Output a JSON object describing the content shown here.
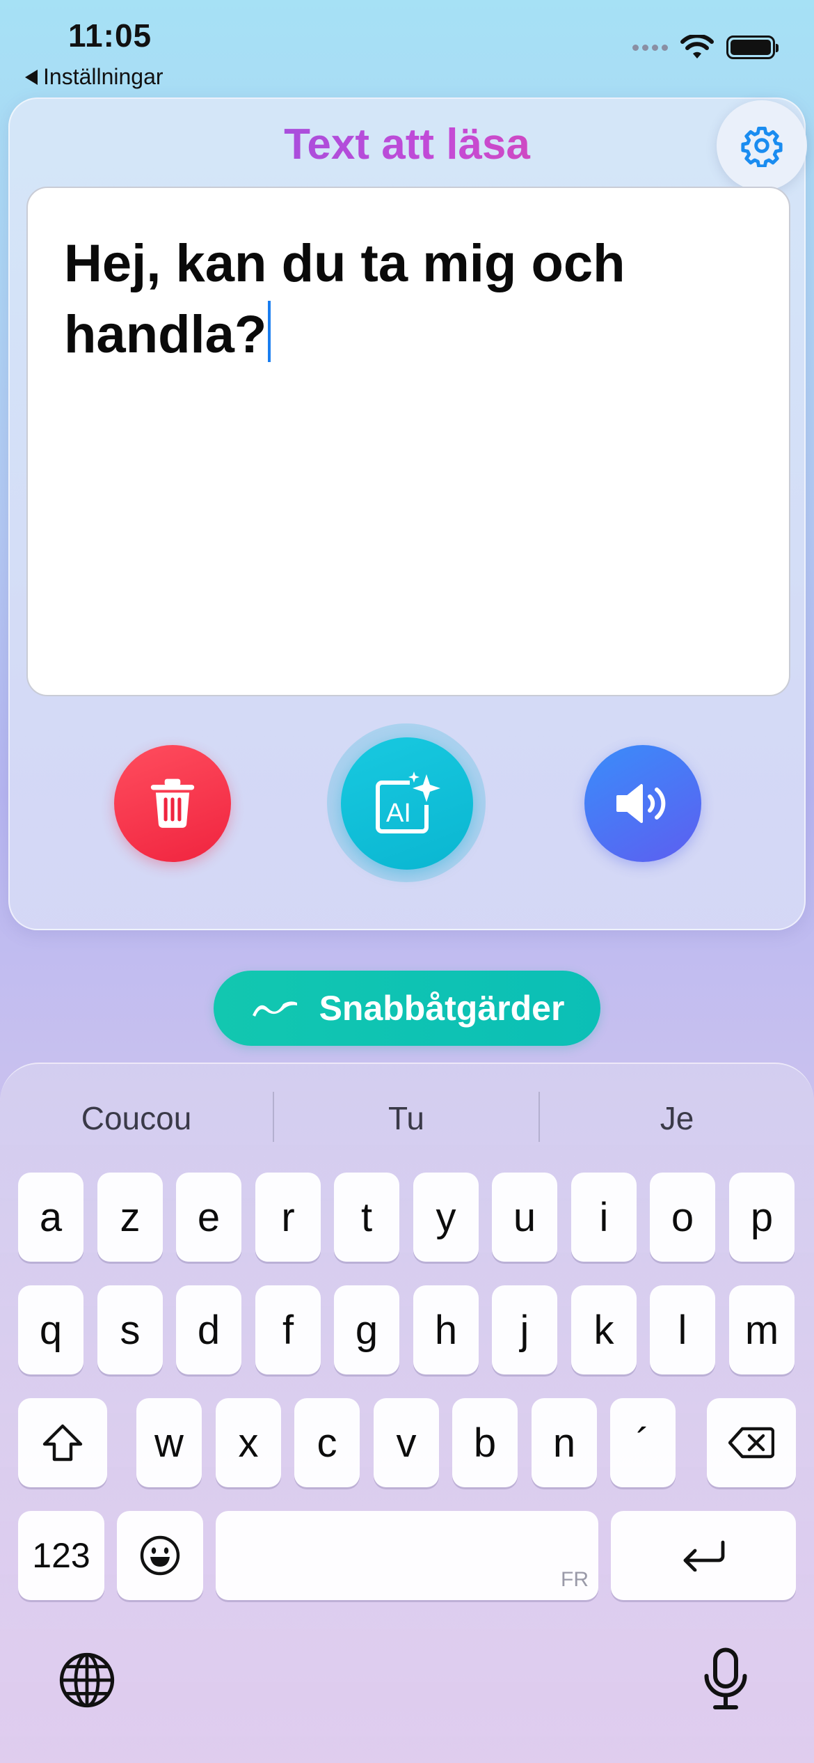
{
  "status_bar": {
    "time": "11:05",
    "back_label": "Inställningar"
  },
  "card": {
    "title": "Text att läsa",
    "text": "Hej, kan du ta mig och handla?"
  },
  "buttons": {
    "quick_actions": "Snabbåtgärder"
  },
  "keyboard": {
    "suggestions": [
      "Coucou",
      "Tu",
      "Je"
    ],
    "row1": [
      "a",
      "z",
      "e",
      "r",
      "t",
      "y",
      "u",
      "i",
      "o",
      "p"
    ],
    "row2": [
      "q",
      "s",
      "d",
      "f",
      "g",
      "h",
      "j",
      "k",
      "l",
      "m"
    ],
    "row3": [
      "w",
      "x",
      "c",
      "v",
      "b",
      "n",
      "´"
    ],
    "numbers_key": "123",
    "space_language": "FR"
  },
  "icons": {
    "settings": "gear-icon",
    "delete": "trash-icon",
    "ai": "ai-sparkle-icon",
    "speak": "speaker-icon",
    "quick": "wave-icon",
    "shift": "shift-icon",
    "backspace": "backspace-icon",
    "emoji": "emoji-icon",
    "return": "return-icon",
    "globe": "globe-icon",
    "mic": "microphone-icon"
  },
  "colors": {
    "delete": "#f0243f",
    "ai": "#0ab6d1",
    "speak": "#4a75f4",
    "quick": "#12c7b0",
    "settings_icon": "#1a8cf0",
    "caret": "#1a7ef0"
  }
}
